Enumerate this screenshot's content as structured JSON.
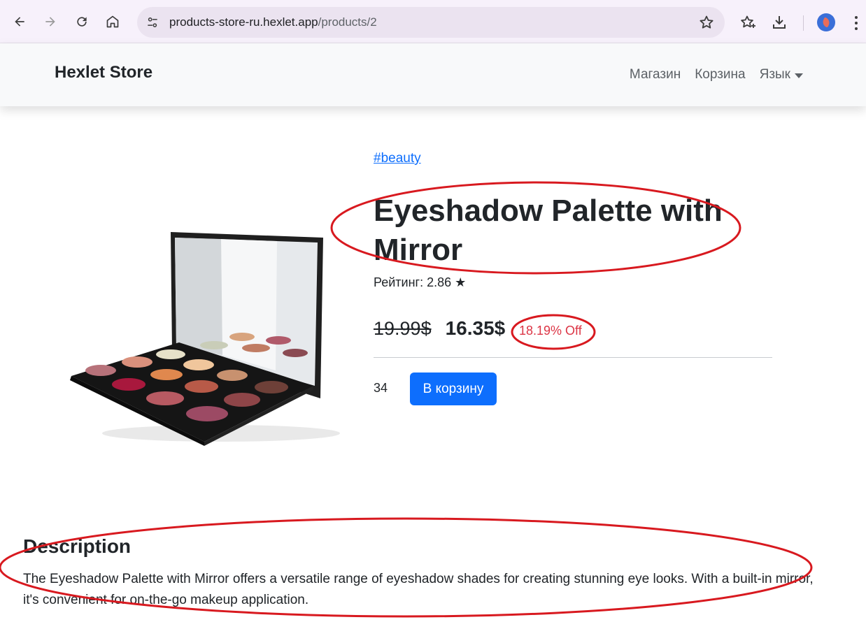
{
  "browser": {
    "url_host": "products-store-ru.hexlet.app",
    "url_path": "/products/2"
  },
  "navbar": {
    "brand": "Hexlet Store",
    "links": [
      "Магазин",
      "Корзина"
    ],
    "language_label": "Язык"
  },
  "product": {
    "tag": "#beauty",
    "title": "Eyeshadow Palette with Mirror",
    "rating": "Рейтинг: 2.86 ★",
    "old_price": "19.99$",
    "price": "16.35$",
    "discount": "18.19% Off",
    "stock": "34",
    "add_to_cart_label": "В корзину"
  },
  "description": {
    "title": "Description",
    "text": "The Eyeshadow Palette with Mirror offers a versatile range of eyeshadow shades for creating stunning eye looks. With a built-in mirror, it's convenient for on-the-go makeup application."
  },
  "colors": {
    "accent": "#0d6efd",
    "discount": "#dc3545",
    "annotation": "#d8191f"
  },
  "icons": [
    "back-arrow-icon",
    "forward-arrow-icon",
    "reload-icon",
    "home-icon",
    "site-settings-icon",
    "bookmark-star-icon",
    "bookmarks-icon",
    "download-icon",
    "profile-avatar",
    "menu-kebab-icon"
  ]
}
